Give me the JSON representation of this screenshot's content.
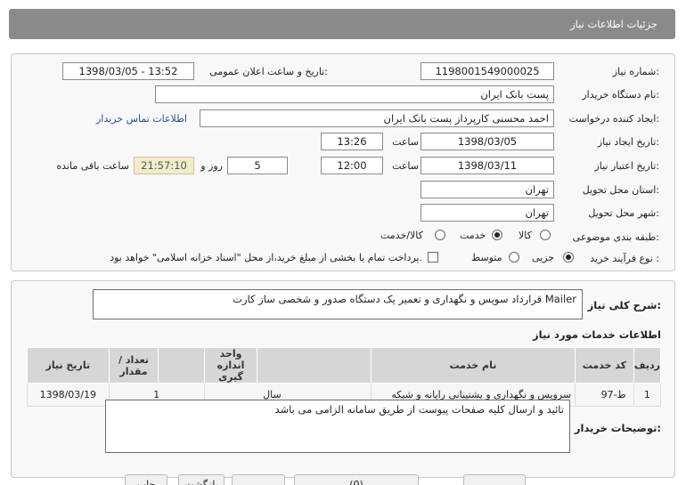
{
  "header": {
    "title": "جزئیات اطلاعات نیاز"
  },
  "form": {
    "need_number_label": "شماره نیاز:",
    "need_number": "1198001549000025",
    "announce_label": "تاریخ و ساعت اعلان عمومی:",
    "announce_value": "1398/03/05 - 13:52",
    "buyer_org_label": "نام دستگاه خریدار:",
    "buyer_org": "پست بانک ایران",
    "requester_label": "ایجاد کننده درخواست:",
    "requester": "احمد  محسنی کارپرداز پست بانک ایران",
    "contact_link": "اطلاعات تماس خریدار",
    "created_label": "تاریخ ایجاد نیاز:",
    "created_date": "1398/03/05",
    "time_label": "ساعت",
    "created_time": "13:26",
    "valid_label": "تاریخ اعتبار نیاز:",
    "valid_date": "1398/03/11",
    "valid_time": "12:00",
    "days": "5",
    "days_label": "روز و",
    "remaining": "21:57:10",
    "remaining_label": "ساعت باقی مانده",
    "province_label": "استان محل تحویل:",
    "province": "تهران",
    "city_label": "شهر محل تحویل:",
    "city": "تهران",
    "category_label": "طبقه بندی موضوعی:",
    "category_options": [
      "کالا",
      "خدمت",
      "کالا/خدمت"
    ],
    "category_selected": "خدمت",
    "process_label": "نوع فرآیند خرید :",
    "process_options": [
      "جزیی",
      "متوسط"
    ],
    "process_selected": "جزیی",
    "payment_note": "پرداخت تمام یا بخشی از مبلغ خرید،از محل \"اسناد خزانه اسلامی\" خواهد بود."
  },
  "summary": {
    "label": "شرح کلی نیاز:",
    "text": "قرارداد سویس و نگهداری و تعمیر یک دستگاه صدور و شخصی ساز کارت Mailer"
  },
  "services": {
    "title": "اطلاعات خدمات مورد نیاز",
    "columns": [
      "ردیف",
      "کد خدمت",
      "نام خدمت",
      "واحد اندازه گیری",
      "تعداد / مقدار",
      "تاریخ نیاز"
    ],
    "rows": [
      {
        "row": "1",
        "code": "ط-97",
        "name": "سرویس و نگهداری و پشتیبانی رایانه و شبکه",
        "unit": "سال",
        "qty": "1",
        "date": "1398/03/19"
      }
    ]
  },
  "buyer_notes": {
    "label": "توضیحات خریدار:",
    "text": "تائید و ارسال کلیه صفحات پیوست از طریق سامانه الزامی می باشد"
  },
  "buttons": {
    "b1": "",
    "b2": "(0)",
    "b3": "",
    "b4": "بازگشت",
    "b5": "چاپ"
  },
  "colors": {
    "header_bg": "#8a8a8a",
    "timer_bg": "#f1ecc9",
    "link": "#1a4ea0"
  }
}
